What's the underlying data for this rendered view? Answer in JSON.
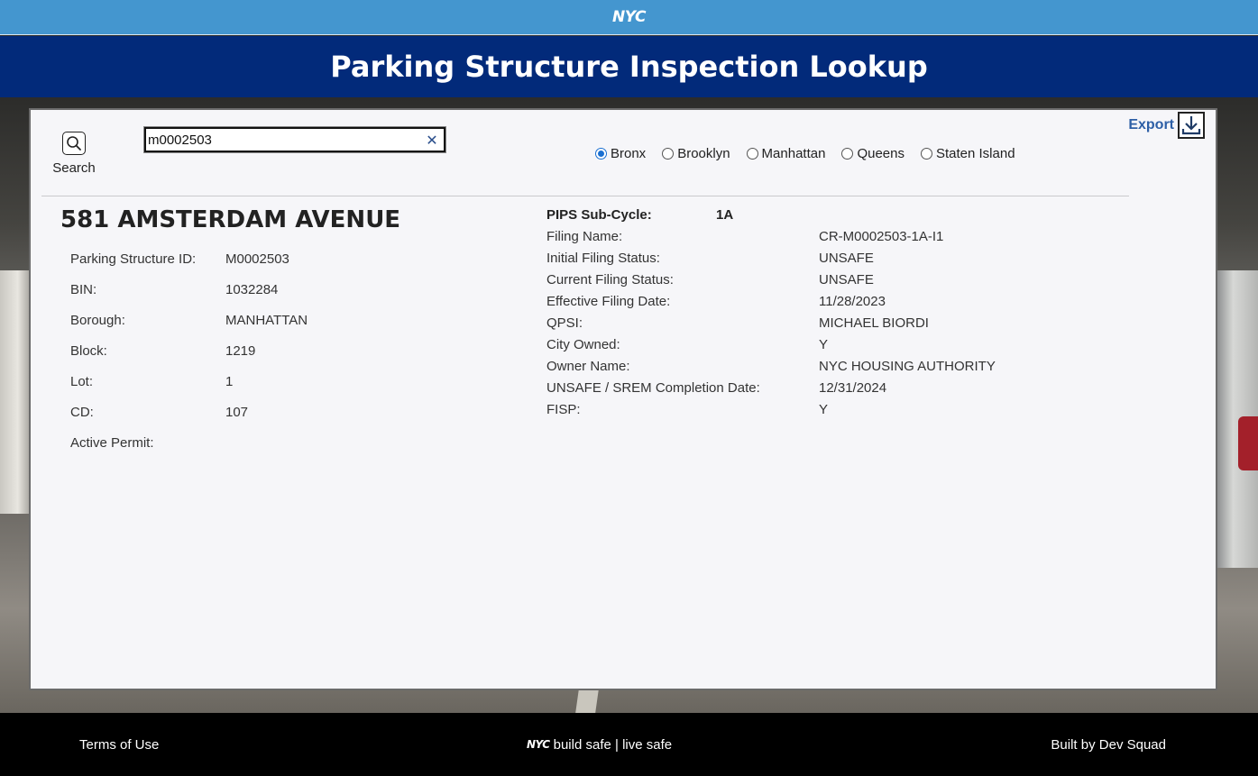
{
  "top_bar": {
    "logo": "NYC"
  },
  "header": {
    "title": "Parking Structure Inspection Lookup"
  },
  "search": {
    "button_label": "Search",
    "input_value": "m0002503",
    "clear_symbol": "✕"
  },
  "export": {
    "label": "Export"
  },
  "boroughs": {
    "selected": "Bronx",
    "options": [
      "Bronx",
      "Brooklyn",
      "Manhattan",
      "Queens",
      "Staten Island"
    ]
  },
  "property": {
    "address": "581 AMSTERDAM AVENUE",
    "fields": [
      {
        "label": "Parking Structure ID:",
        "value": "M0002503"
      },
      {
        "label": "BIN:",
        "value": "1032284"
      },
      {
        "label": "Borough:",
        "value": "MANHATTAN"
      },
      {
        "label": "Block:",
        "value": "1219"
      },
      {
        "label": "Lot:",
        "value": "1"
      },
      {
        "label": "CD:",
        "value": "107"
      },
      {
        "label": "Active Permit:",
        "value": ""
      }
    ]
  },
  "filing": {
    "subcycle_label": "PIPS Sub-Cycle:",
    "subcycle_value": "1A",
    "fields": [
      {
        "label": "Filing Name:",
        "value": "CR-M0002503-1A-I1"
      },
      {
        "label": "Initial Filing Status:",
        "value": "UNSAFE"
      },
      {
        "label": "Current Filing Status:",
        "value": "UNSAFE"
      },
      {
        "label": "Effective Filing Date:",
        "value": "11/28/2023"
      },
      {
        "label": "QPSI:",
        "value": "MICHAEL BIORDI"
      },
      {
        "label": "City Owned:",
        "value": "Y"
      },
      {
        "label": "Owner Name:",
        "value": "NYC HOUSING AUTHORITY"
      },
      {
        "label": "UNSAFE / SREM Completion Date:",
        "value": "12/31/2024"
      },
      {
        "label": "FISP:",
        "value": "Y"
      }
    ]
  },
  "footer": {
    "terms": "Terms of Use",
    "tagline_logo": "NYC",
    "tagline": "build safe | live safe",
    "built_by": "Built by Dev Squad"
  },
  "icons": {
    "search": "magnifier-icon",
    "export": "download-icon",
    "clear": "close-icon"
  },
  "colors": {
    "top_bar": "#4496cf",
    "title_bar": "#022a7a",
    "export_text": "#2d5fa6",
    "radio_selected": "#1a6fd1",
    "footer": "#000000"
  }
}
